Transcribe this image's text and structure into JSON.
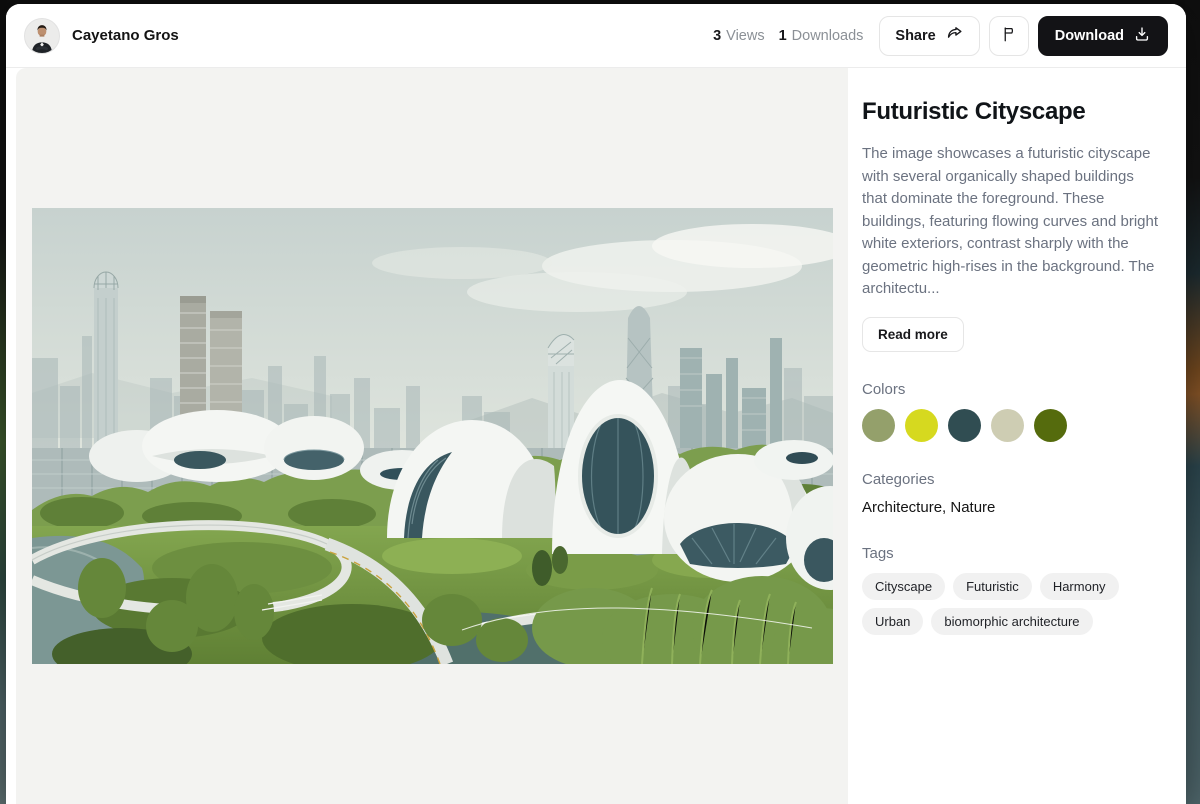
{
  "header": {
    "user_name": "Cayetano Gros",
    "views_count": "3",
    "views_label": "Views",
    "downloads_count": "1",
    "downloads_label": "Downloads",
    "share_label": "Share",
    "download_label": "Download"
  },
  "sidebar": {
    "title": "Futuristic Cityscape",
    "description": "The image showcases a futuristic cityscape with several organically shaped buildings that dominate the foreground. These buildings, featuring flowing curves and bright white exteriors, contrast sharply with the geometric high-rises in the background. The architectu...",
    "read_more_label": "Read more",
    "colors_label": "Colors",
    "colors": [
      "#94A06B",
      "#D6D91F",
      "#304D52",
      "#CECDB3",
      "#556B0D"
    ],
    "categories_label": "Categories",
    "categories_value": "Architecture,  Nature",
    "tags_label": "Tags",
    "tags": [
      "Cityscape",
      "Futuristic",
      "Harmony",
      "Urban",
      "biomorphic architecture"
    ]
  }
}
